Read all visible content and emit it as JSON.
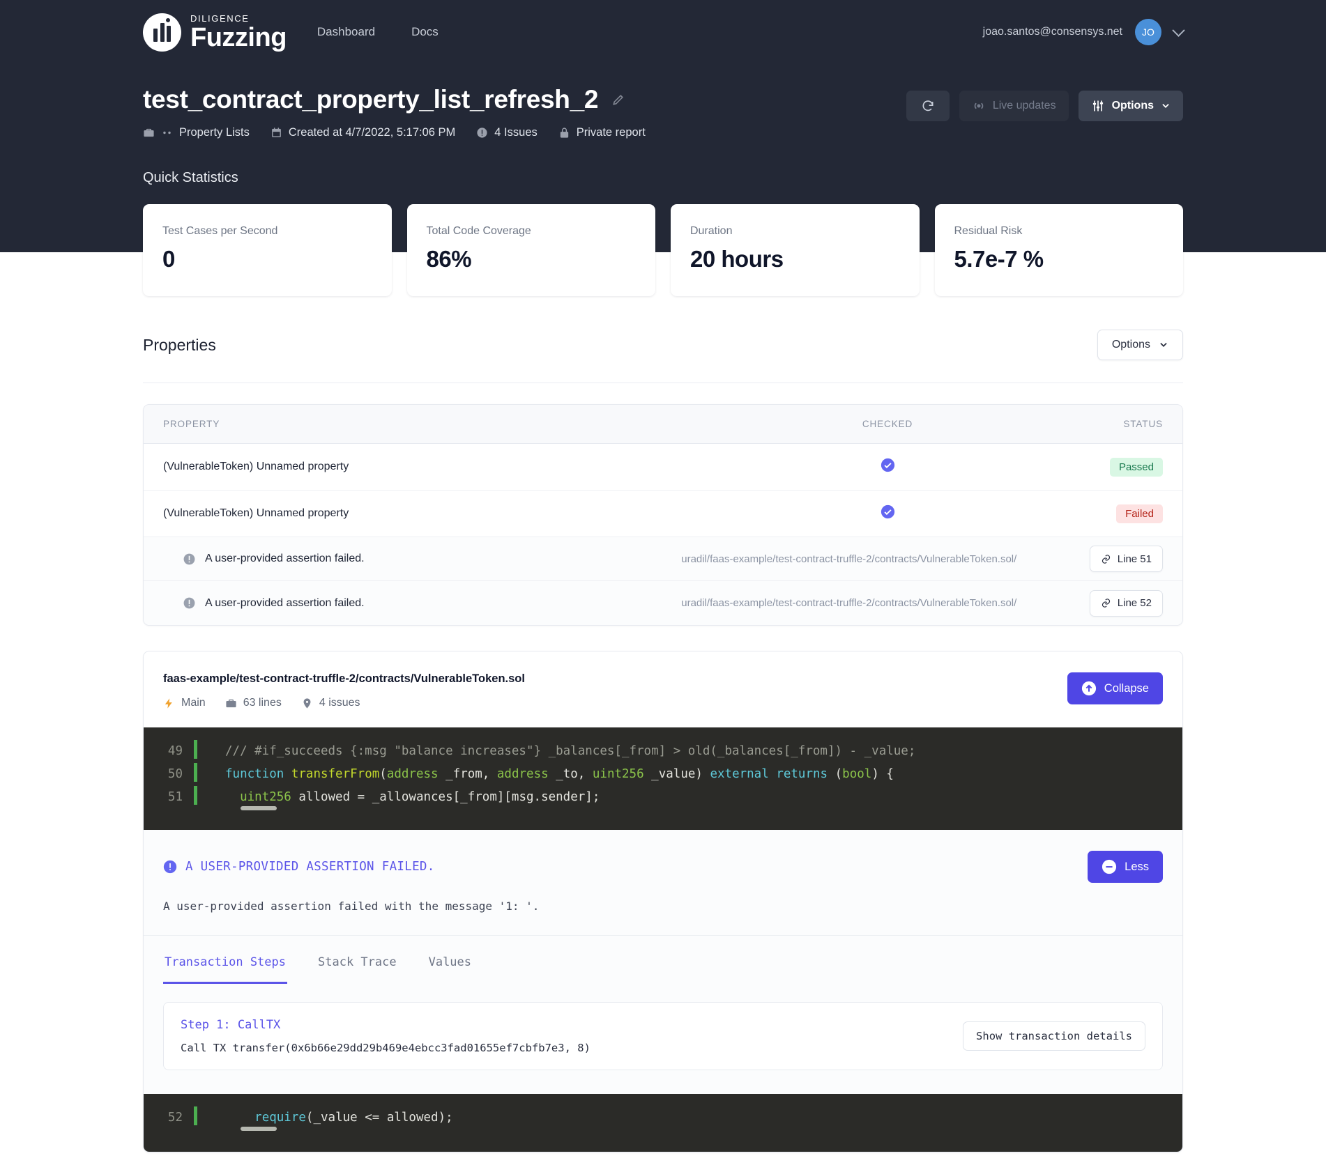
{
  "brand": {
    "small": "DILIGENCE",
    "main": "Fuzzing"
  },
  "nav": {
    "links": [
      {
        "label": "Dashboard"
      },
      {
        "label": "Docs"
      }
    ]
  },
  "user": {
    "email": "joao.santos@consensys.net",
    "initials": "JO"
  },
  "report": {
    "title": "test_contract_property_list_refresh_2",
    "meta": [
      {
        "icon": "briefcase-icon",
        "label": "Property Lists",
        "prefix": "--"
      },
      {
        "icon": "calendar-icon",
        "label": "Created at 4/7/2022, 5:17:06 PM"
      },
      {
        "icon": "alert-icon",
        "label": "4 Issues"
      },
      {
        "icon": "lock-icon",
        "label": "Private report"
      }
    ],
    "actions": {
      "refresh_icon": "refresh-icon",
      "live_updates": "Live updates",
      "options": "Options"
    }
  },
  "quick_statistics": {
    "heading": "Quick Statistics",
    "cards": [
      {
        "label": "Test Cases per Second",
        "value": "0"
      },
      {
        "label": "Total Code Coverage",
        "value": "86%"
      },
      {
        "label": "Duration",
        "value": "20 hours"
      },
      {
        "label": "Residual Risk",
        "value": "5.7e-7 %"
      }
    ]
  },
  "properties": {
    "heading": "Properties",
    "options_label": "Options",
    "columns": {
      "property": "PROPERTY",
      "checked": "CHECKED",
      "status": "STATUS"
    },
    "rows": [
      {
        "name": "(VulnerableToken) Unnamed property",
        "checked": true,
        "status": "Passed",
        "status_kind": "pass"
      },
      {
        "name": "(VulnerableToken) Unnamed property",
        "checked": true,
        "status": "Failed",
        "status_kind": "fail"
      }
    ],
    "issues": [
      {
        "title": "A user-provided assertion failed.",
        "path": "uradil/faas-example/test-contract-truffle-2/contracts/VulnerableToken.sol/",
        "line_label": "Line 51"
      },
      {
        "title": "A user-provided assertion failed.",
        "path": "uradil/faas-example/test-contract-truffle-2/contracts/VulnerableToken.sol/",
        "line_label": "Line 52"
      }
    ]
  },
  "file_panel": {
    "path": "faas-example/test-contract-truffle-2/contracts/VulnerableToken.sol",
    "meta": [
      {
        "icon": "bolt-icon",
        "label": "Main"
      },
      {
        "icon": "briefcase-icon",
        "label": "63 lines"
      },
      {
        "icon": "pin-icon",
        "label": "4 issues"
      }
    ],
    "collapse_label": "Collapse",
    "code_top": [
      {
        "number": "49",
        "text": "/// #if_succeeds {:msg \"balance increases\"} _balances[_from] > old(_balances[_from]) - _value;"
      },
      {
        "number": "50",
        "text": "function transferFrom(address _from, address _to, uint256 _value) external returns (bool) {"
      },
      {
        "number": "51",
        "text": "  uint256 allowed = _allowances[_from][msg.sender];"
      }
    ],
    "code_bottom": [
      {
        "number": "52",
        "text": "    require(_value <= allowed);"
      }
    ],
    "assertion": {
      "title": "A USER-PROVIDED ASSERTION FAILED.",
      "message": "A user-provided assertion failed with the message '1: '.",
      "less_label": "Less"
    },
    "tabs": [
      {
        "label": "Transaction Steps",
        "active": true
      },
      {
        "label": "Stack Trace",
        "active": false
      },
      {
        "label": "Values",
        "active": false
      }
    ],
    "step": {
      "title": "Step 1: CallTX",
      "body": "Call TX transfer(0x6b66e29dd29b469e4ebcc3fad01655ef7cbfb7e3, 8)",
      "details_label": "Show transaction details"
    }
  },
  "colors": {
    "header_bg": "#232836",
    "accent_purple": "#4f46e5",
    "pass_bg": "#d9f7e4",
    "fail_bg": "#fde2e2",
    "avatar_bg": "#4a90d9",
    "code_bg": "#2b2b28",
    "gutter_green": "#4caf50"
  }
}
